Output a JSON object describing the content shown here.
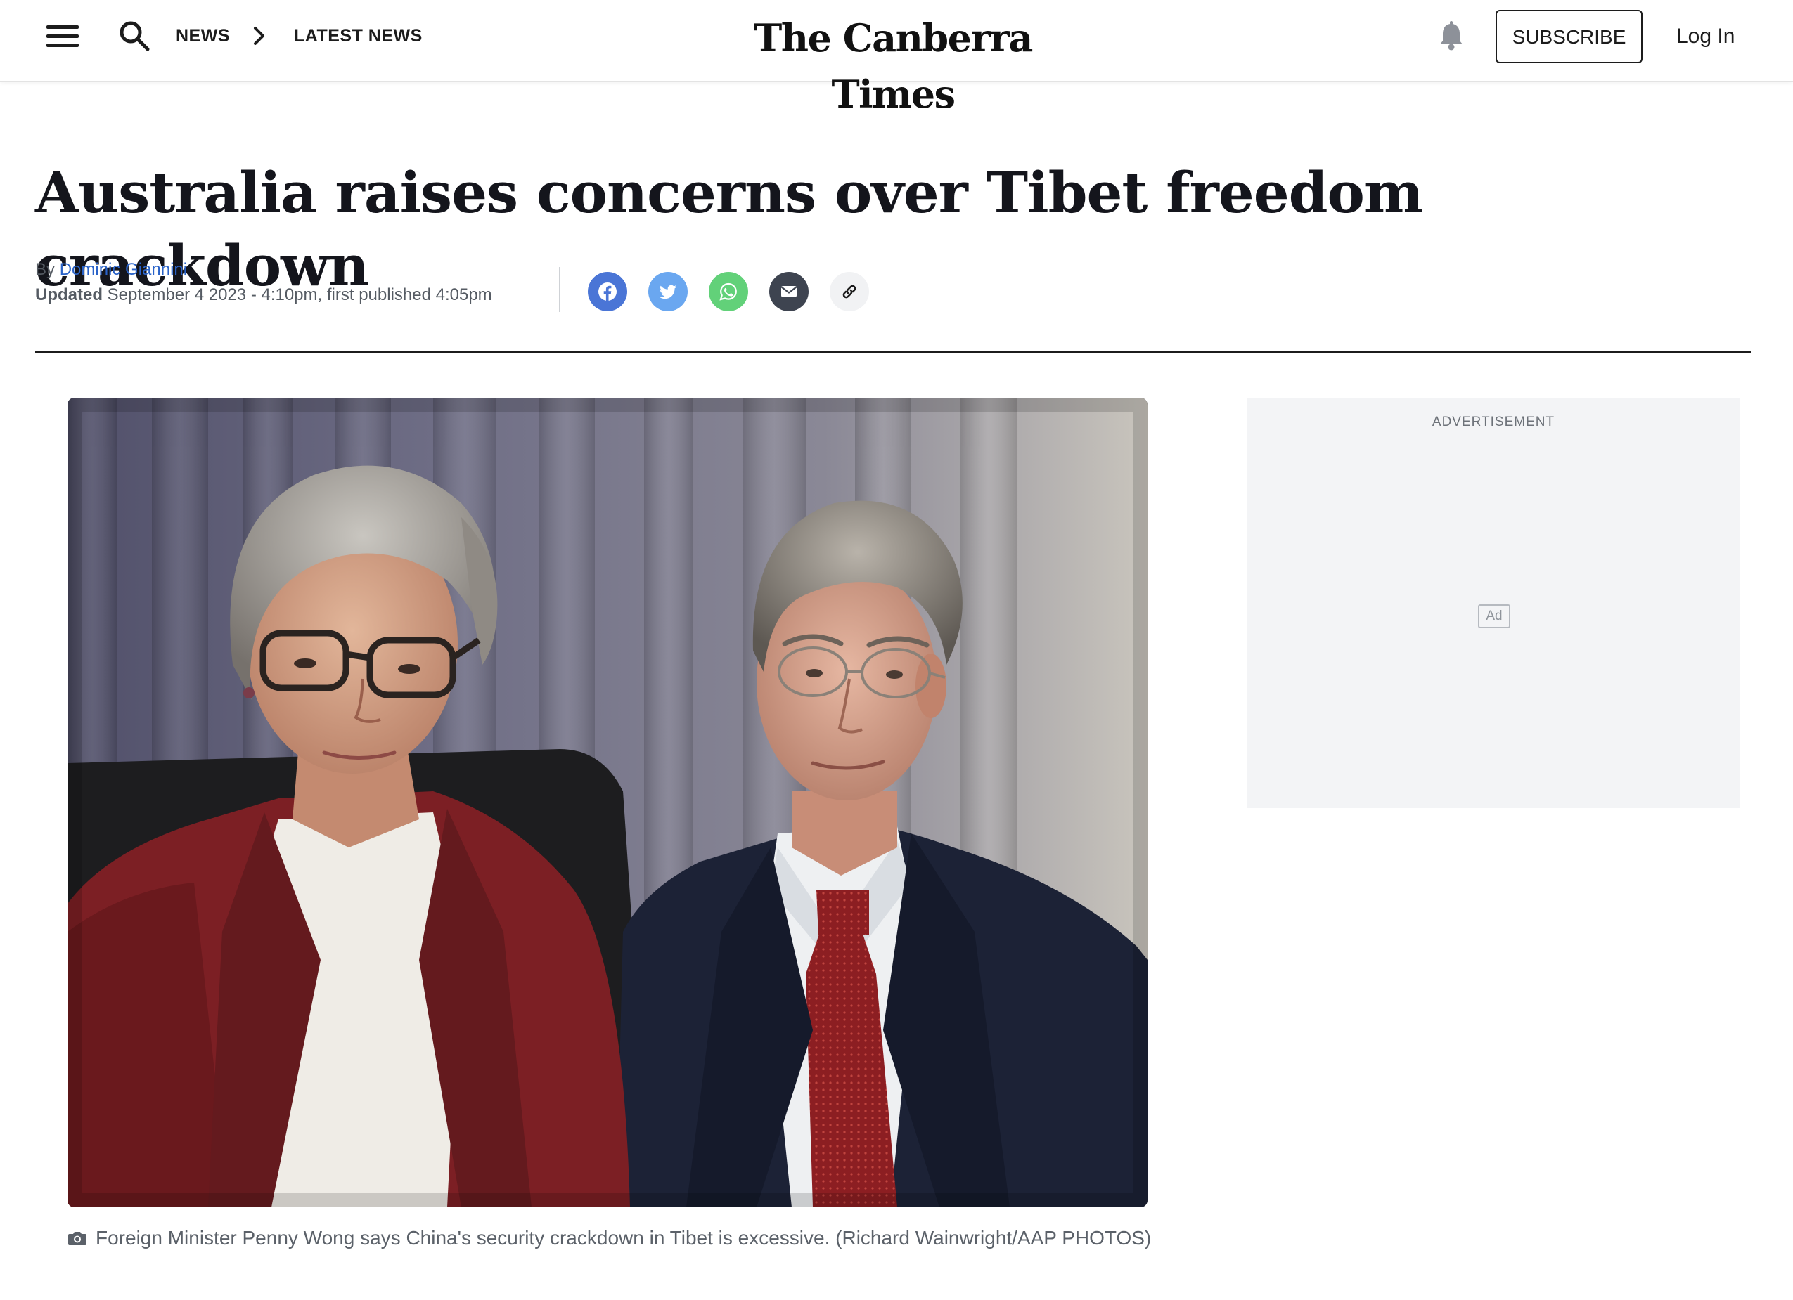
{
  "header": {
    "menu_icon": "hamburger-menu-icon",
    "search_icon": "search-icon",
    "breadcrumb": [
      "NEWS",
      "LATEST NEWS"
    ],
    "masthead": "The Canberra Times",
    "bell_icon": "bell-icon",
    "subscribe_label": "SUBSCRIBE",
    "login_label": "Log In"
  },
  "article": {
    "headline": "Australia raises concerns over Tibet freedom crackdown",
    "by_prefix": "By",
    "author": "Dominic Giannini",
    "updated_label": "Updated",
    "updated_text": "September 4 2023 - 4:10pm, first published 4:05pm",
    "share_icons": [
      "facebook-icon",
      "twitter-icon",
      "whatsapp-icon",
      "email-icon",
      "link-icon"
    ],
    "image_alt": "Foreign Minister Penny Wong and Mark Dreyfus",
    "caption": "Foreign Minister Penny Wong says China's security crackdown in Tibet is excessive. (Richard Wainwright/AAP PHOTOS)"
  },
  "ad": {
    "label": "ADVERTISEMENT",
    "badge": "Ad"
  },
  "colors": {
    "link": "#2a63c9",
    "facebook": "#4a75d6",
    "twitter": "#6aa7f0",
    "whatsapp": "#62d179",
    "email": "#3e4450",
    "ad_background": "#f3f4f6"
  }
}
